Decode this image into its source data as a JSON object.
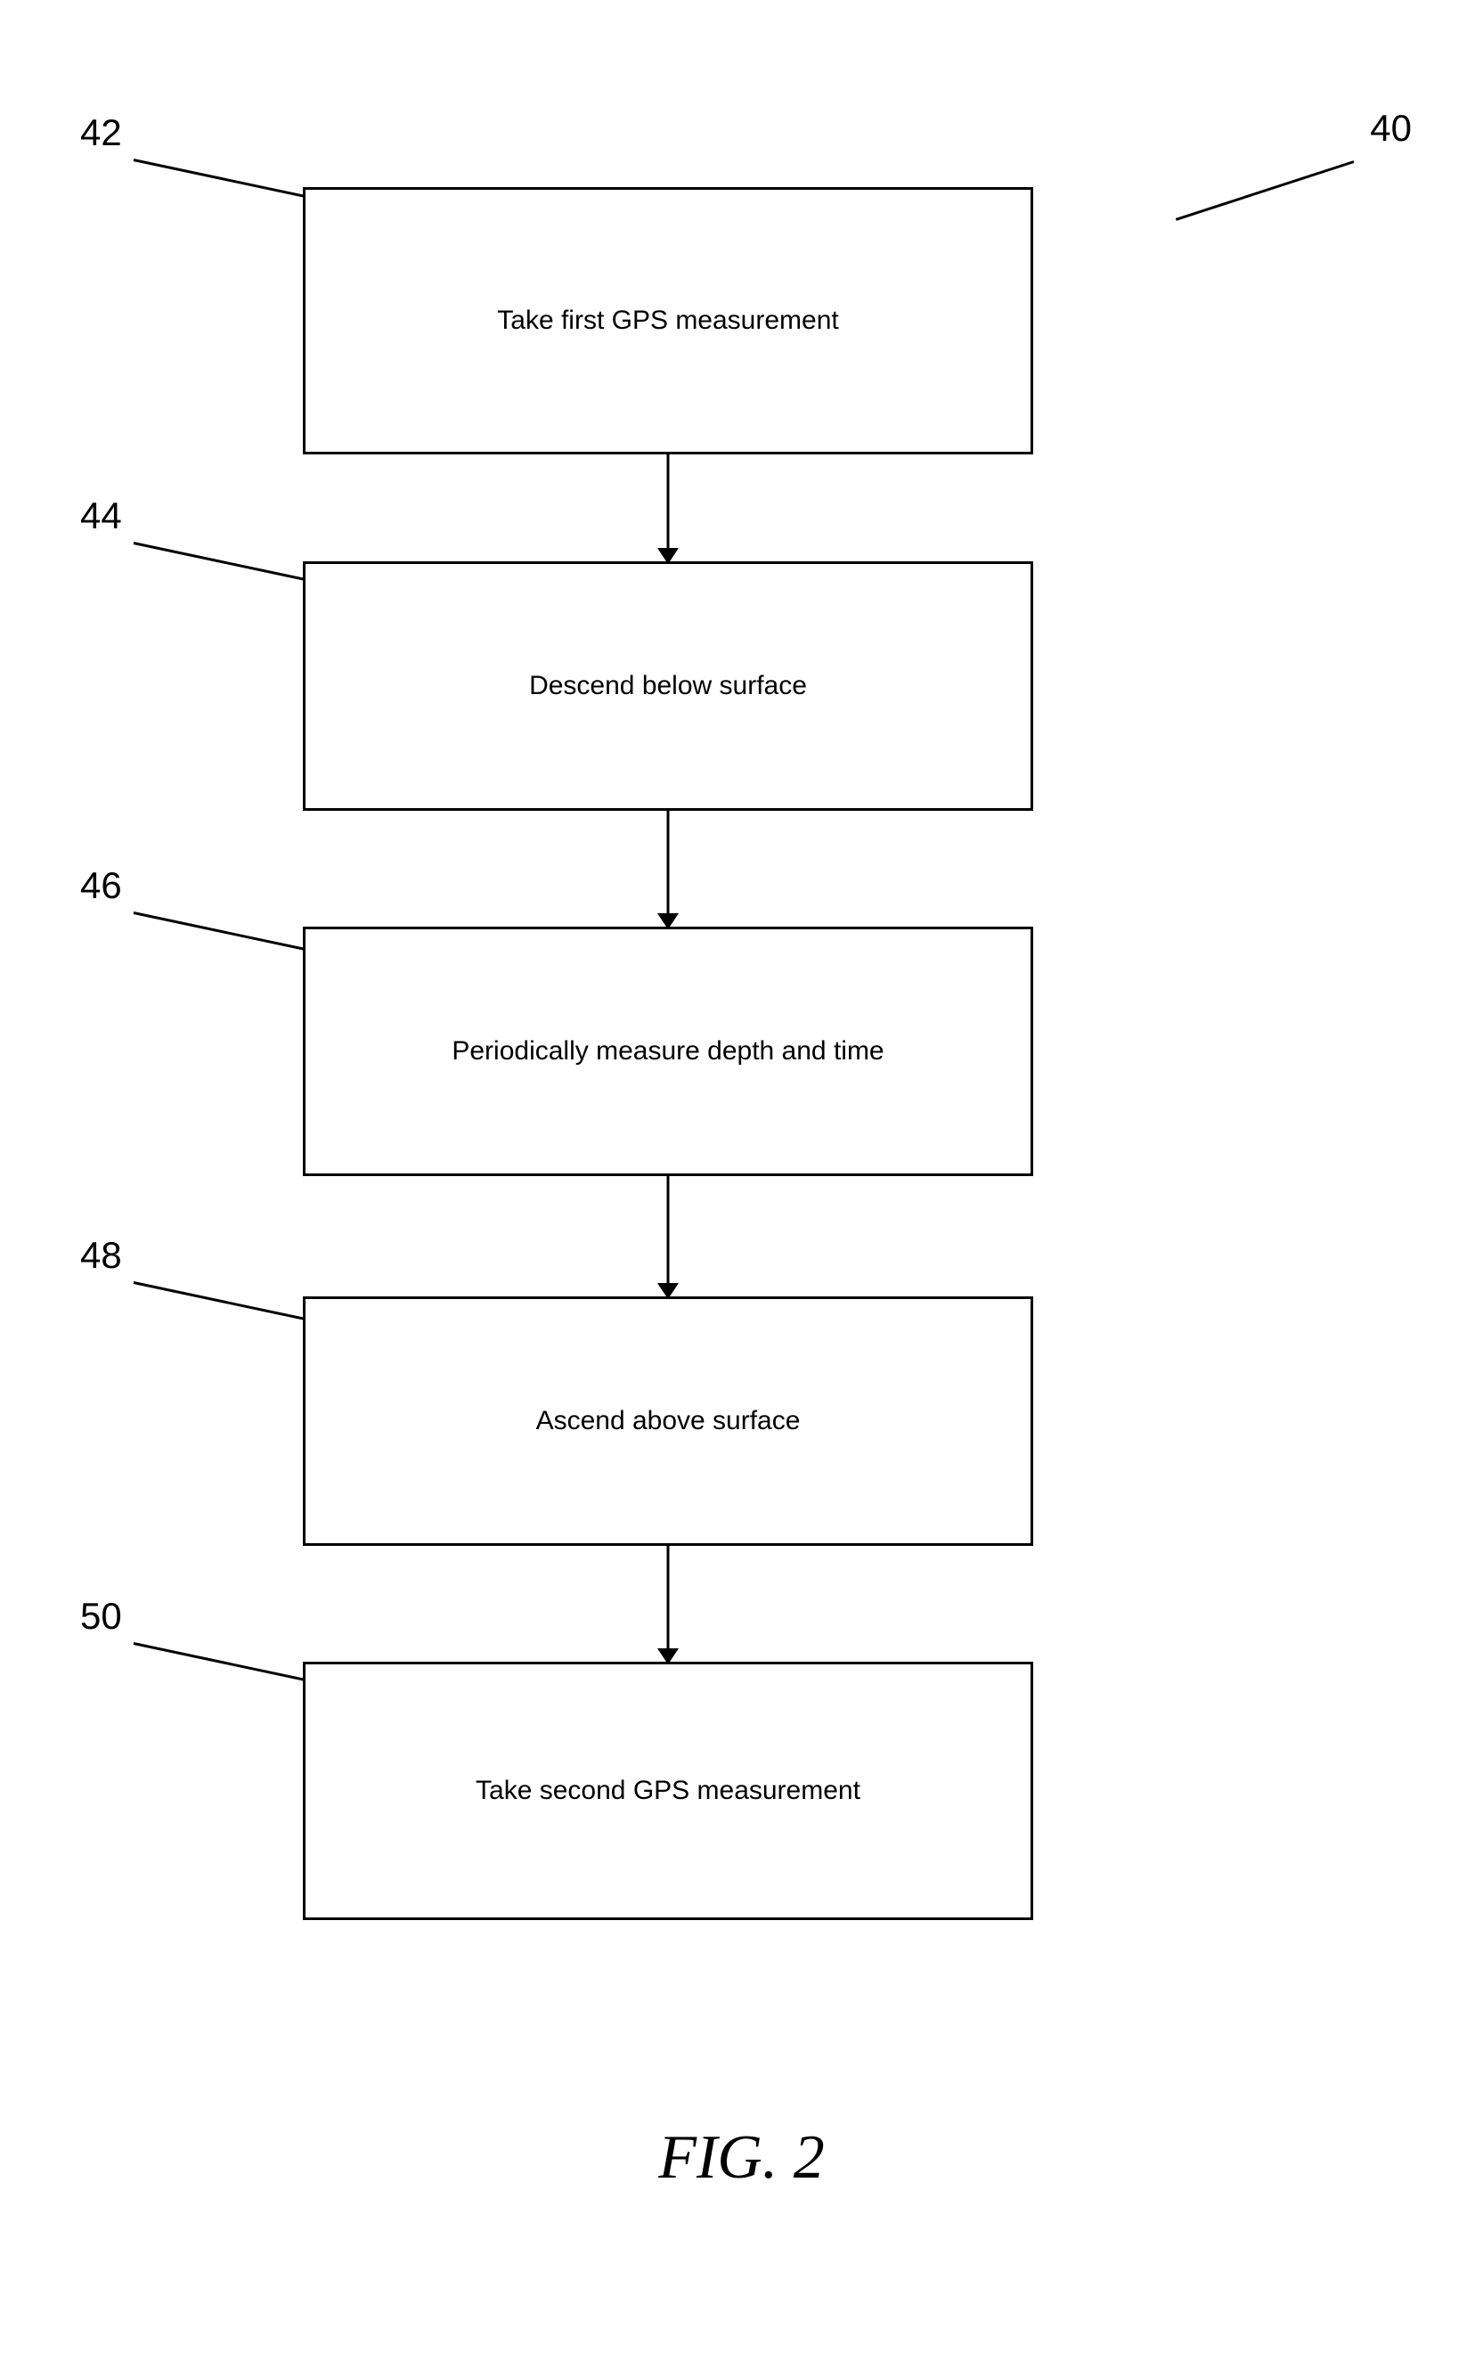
{
  "refs": {
    "r40": "40",
    "r42": "42",
    "r44": "44",
    "r46": "46",
    "r48": "48",
    "r50": "50"
  },
  "boxes": {
    "b1": "Take first GPS measurement",
    "b2": "Descend below surface",
    "b3": "Periodically measure depth and time",
    "b4": "Ascend above surface",
    "b5": "Take second GPS measurement"
  },
  "caption": "FIG. 2"
}
